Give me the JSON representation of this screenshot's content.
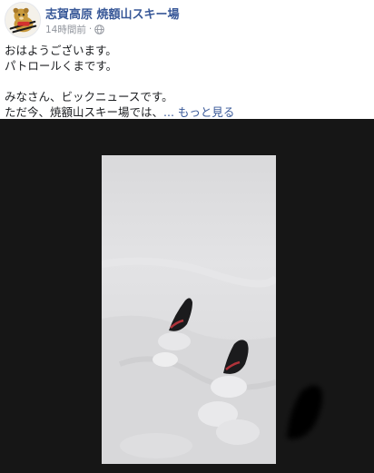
{
  "post": {
    "page_name": "志賀高原 焼額山スキー場",
    "time": "14時間前",
    "separator": "·",
    "privacy_icon": "globe-icon",
    "lines": [
      "おはようございます。",
      "パトロールくまです。",
      "みなさん、ビックニュースです。",
      "ただ今、焼額山スキー場では、"
    ],
    "ellipsis": "... ",
    "see_more": "もっと見る"
  },
  "media": {
    "type": "video",
    "description_icon": "ski-tips-in-powder-snow"
  },
  "colors": {
    "link": "#385898",
    "meta": "#90949c",
    "media_background": "#161616"
  }
}
